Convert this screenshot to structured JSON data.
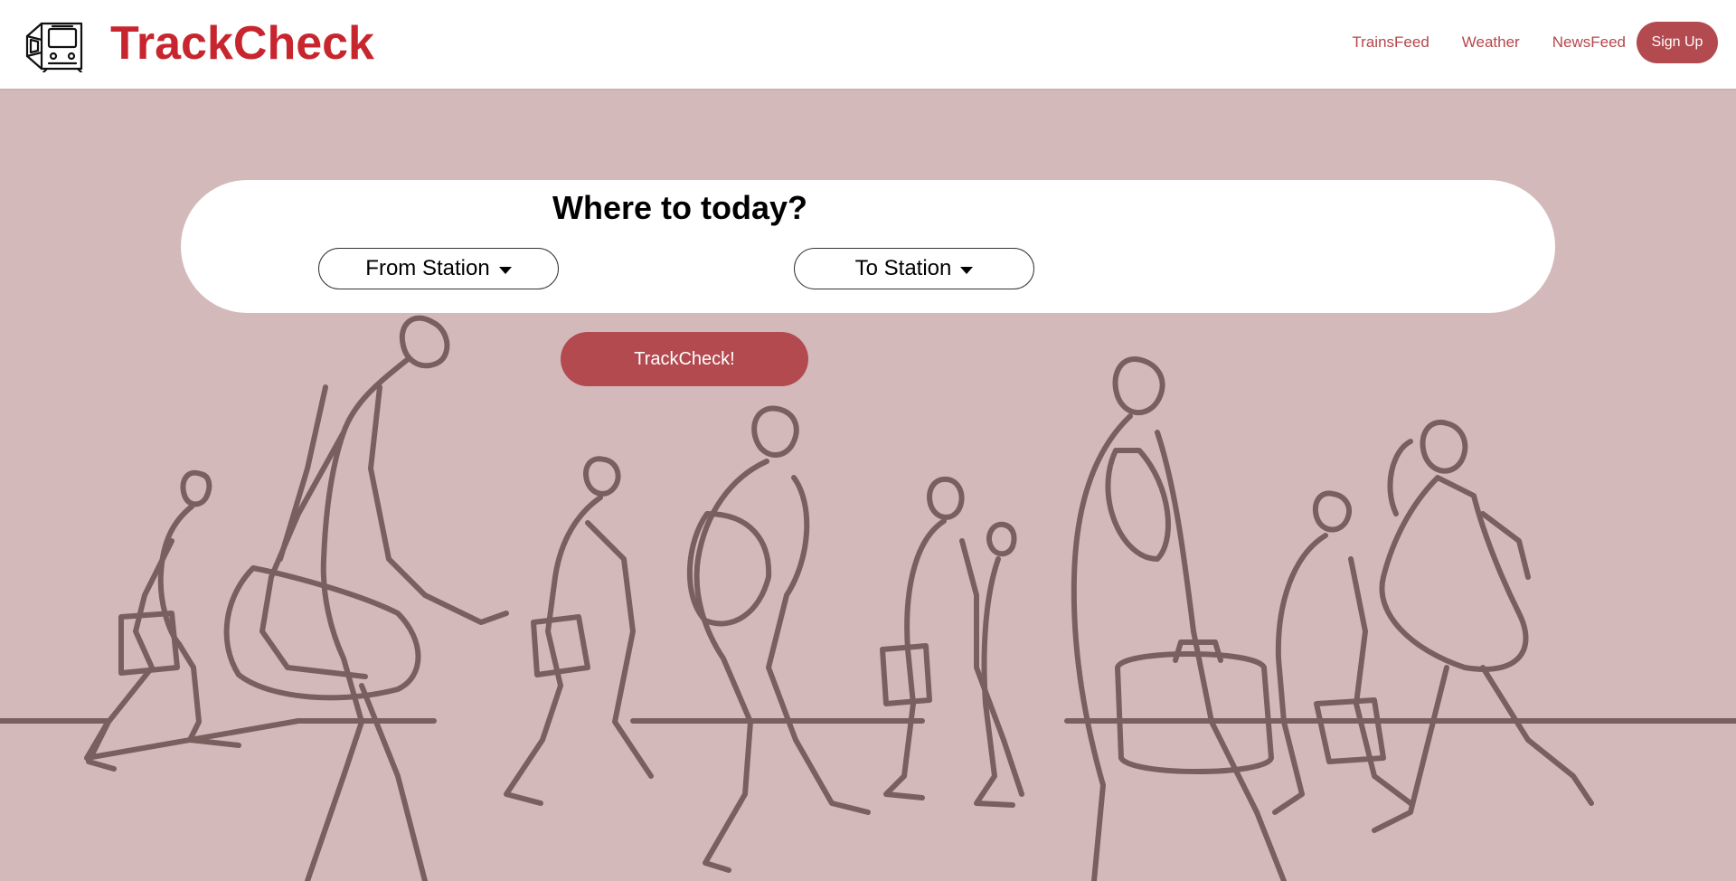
{
  "header": {
    "brand": "TrackCheck",
    "logo_icon": "train-icon",
    "nav": {
      "trainsfeed": "TrainsFeed",
      "weather": "Weather",
      "newsfeed": "NewsFeed"
    },
    "signup_label": "Sign Up"
  },
  "search": {
    "title": "Where to today?",
    "from_label": "From Station",
    "to_label": "To Station",
    "submit_label": "TrackCheck!"
  },
  "colors": {
    "brand_red": "#c8262e",
    "accent": "#b24a4f",
    "hero_bg": "#d4b9ba",
    "line_art": "#7a5f5f"
  }
}
